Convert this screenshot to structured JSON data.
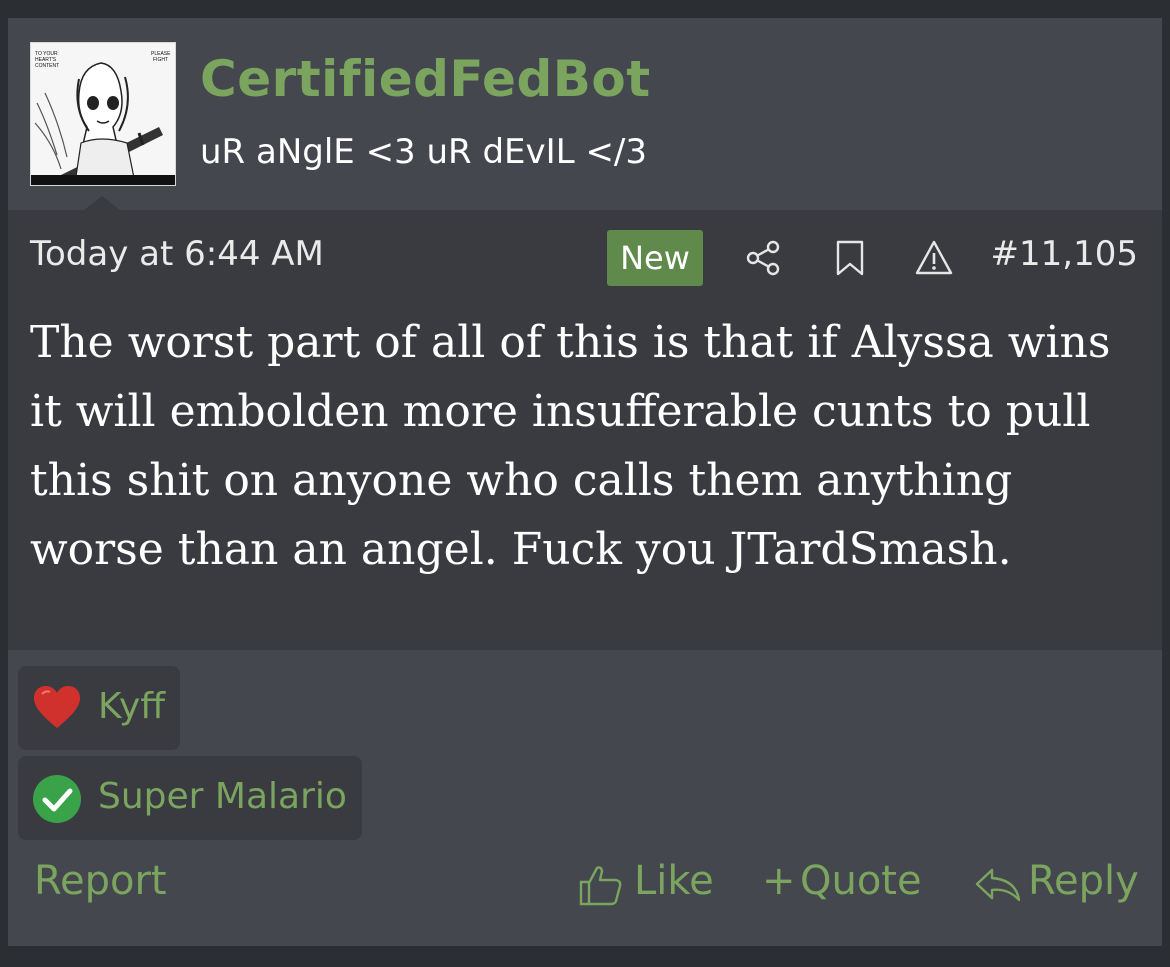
{
  "user": {
    "name": "CertifiedFedBot",
    "title": "uR aNglE <3 uR dEvIL </3",
    "avatar_text_left": "TO YOUR HEART'S CONTENT !",
    "avatar_text_right": "PLEASE FIGHT"
  },
  "post": {
    "date": "Today at 6:44 AM",
    "badge": "New",
    "number": "#11,105",
    "message": "The worst part of all of this is that if Alyssa wins it will embolden more insufferable cunts to pull this shit on anyone who calls them anything worse than an angel. Fuck you JTardSmash.",
    "icons": [
      "share-icon",
      "bookmark-icon",
      "warning-icon"
    ]
  },
  "reactions": [
    {
      "icon": "heart-icon",
      "user": "Kyff",
      "color": "#d0312d"
    },
    {
      "icon": "check-circle-icon",
      "user": "Super Malario",
      "color": "#3aa34a"
    }
  ],
  "actions": {
    "report": "Report",
    "like": "Like",
    "quote": "Quote",
    "reply": "Reply"
  },
  "colors": {
    "accent": "#7ba55f",
    "badge": "#5f8a4c",
    "header_bg": "#44474e",
    "body_bg": "#393b40"
  }
}
